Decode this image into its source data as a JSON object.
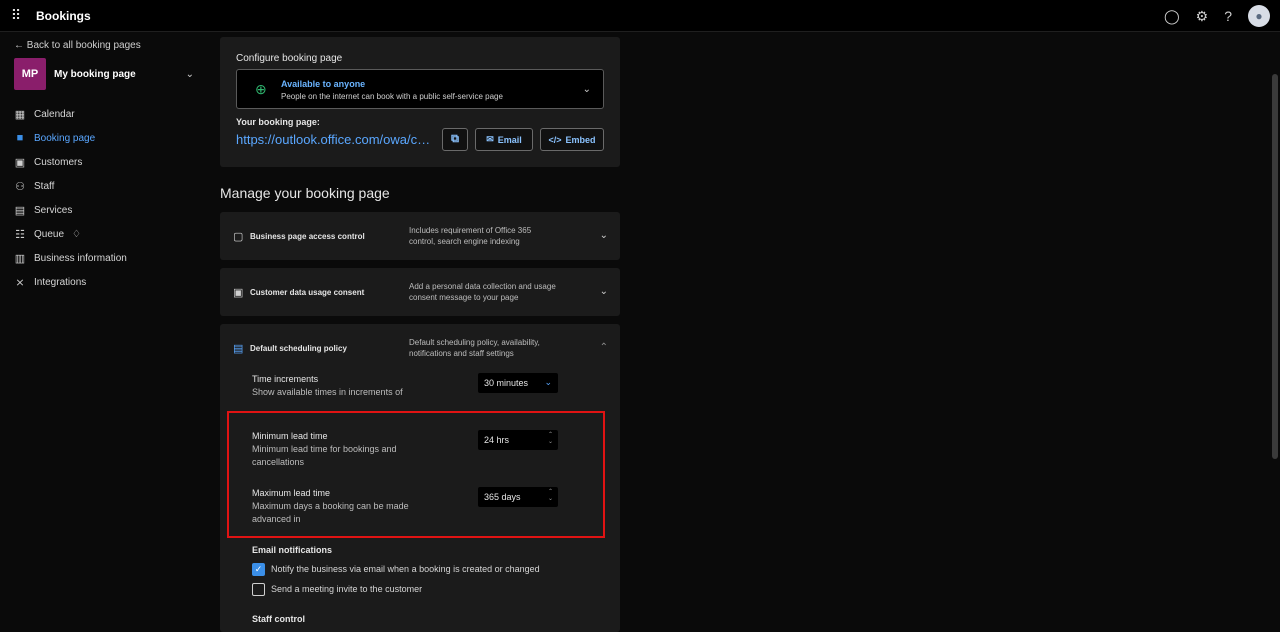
{
  "topbar": {
    "app_title": "Bookings",
    "icons": [
      "waffle-icon",
      "lightbulb-icon",
      "gear-icon",
      "help-icon",
      "avatar"
    ]
  },
  "sidebar": {
    "back_label": "← Back to all booking pages",
    "page_initials": "MP",
    "page_name": "My booking page",
    "items": [
      {
        "label": "Calendar",
        "icon": "calendar-icon",
        "active": false
      },
      {
        "label": "Booking page",
        "icon": "booking-page-icon",
        "active": true
      },
      {
        "label": "Customers",
        "icon": "customers-icon",
        "active": false
      },
      {
        "label": "Staff",
        "icon": "staff-icon",
        "active": false
      },
      {
        "label": "Services",
        "icon": "services-icon",
        "active": false
      },
      {
        "label": "Queue",
        "icon": "queue-icon",
        "active": false
      },
      {
        "label": "Business information",
        "icon": "business-icon",
        "active": false
      },
      {
        "label": "Integrations",
        "icon": "integrations-icon",
        "active": false
      }
    ]
  },
  "config": {
    "title": "Configure booking page",
    "visibility_title": "Available to anyone",
    "visibility_sub": "People on the internet can book with a public self-service page",
    "url_label": "Your booking page:",
    "url_text": "https://outlook.office.com/owa/calen...",
    "email_label": "Email",
    "embed_label": "Embed"
  },
  "manage": {
    "heading": "Manage your booking page",
    "sections": [
      {
        "title": "Business page access control",
        "desc": "Includes requirement of Office 365 control, search engine indexing"
      },
      {
        "title": "Customer data usage consent",
        "desc": "Add a personal data collection and usage consent message to your page"
      }
    ]
  },
  "policy": {
    "title": "Default scheduling policy",
    "desc": "Default scheduling policy, availability, notifications and staff settings",
    "time_increments": {
      "title": "Time increments",
      "desc": "Show available times in increments of",
      "value": "30 minutes"
    },
    "min_lead": {
      "title": "Minimum lead time",
      "desc": "Minimum lead time for bookings and cancellations",
      "value": "24 hrs"
    },
    "max_lead": {
      "title": "Maximum lead time",
      "desc": "Maximum days a booking can be made advanced in",
      "value": "365 days"
    },
    "email_heading": "Email notifications",
    "notify_business": {
      "label": "Notify the business via email when a booking is created or changed",
      "checked": true
    },
    "send_invite": {
      "label": "Send a meeting invite to the customer",
      "checked": false
    },
    "staff_heading": "Staff control"
  },
  "colors": {
    "accent": "#3b8fe8",
    "brand_badge": "#8a1e6b",
    "highlight": "#e01313",
    "available": "#2fb56e"
  }
}
